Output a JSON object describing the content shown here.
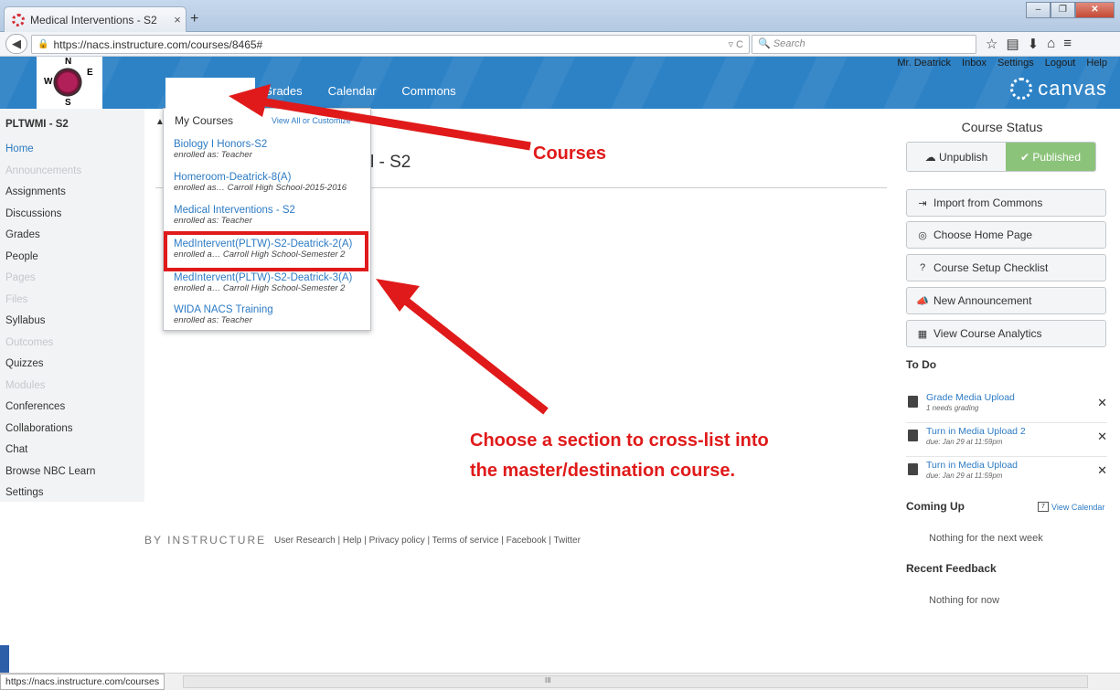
{
  "browser": {
    "tab_title": "Medical Interventions - S2",
    "tab_close": "×",
    "new_tab": "+",
    "url": "https://nacs.instructure.com/courses/8465#",
    "search_placeholder": "Search",
    "status_url": "https://nacs.instructure.com/courses"
  },
  "header": {
    "nav": [
      "Grades",
      "Calendar",
      "Commons"
    ],
    "user_links": [
      "Mr. Deatrick",
      "Inbox",
      "Settings",
      "Logout",
      "Help"
    ],
    "brand": "canvas",
    "logo_letters": {
      "n": "N",
      "w": "W",
      "e": "E",
      "s": "S"
    }
  },
  "left_nav": {
    "course_code": "PLTWMI - S2",
    "items": [
      {
        "label": "Home",
        "state": "active"
      },
      {
        "label": "Announcements",
        "state": "disabled"
      },
      {
        "label": "Assignments",
        "state": "normal"
      },
      {
        "label": "Discussions",
        "state": "normal"
      },
      {
        "label": "Grades",
        "state": "normal"
      },
      {
        "label": "People",
        "state": "normal"
      },
      {
        "label": "Pages",
        "state": "disabled"
      },
      {
        "label": "Files",
        "state": "disabled"
      },
      {
        "label": "Syllabus",
        "state": "normal"
      },
      {
        "label": "Outcomes",
        "state": "disabled"
      },
      {
        "label": "Quizzes",
        "state": "normal"
      },
      {
        "label": "Modules",
        "state": "disabled"
      },
      {
        "label": "Conferences",
        "state": "normal"
      },
      {
        "label": "Collaborations",
        "state": "normal"
      },
      {
        "label": "Chat",
        "state": "normal"
      },
      {
        "label": "Browse NBC Learn",
        "state": "normal"
      },
      {
        "label": "Settings",
        "state": "normal"
      }
    ]
  },
  "main": {
    "page_title": "l - S2"
  },
  "courses_menu": {
    "heading": "My Courses",
    "view_all": "View All or Customize",
    "courses": [
      {
        "name": "Biology I Honors-S2",
        "enrollment": "enrolled as: Teacher"
      },
      {
        "name": "Homeroom-Deatrick-8(A)",
        "enrollment": "enrolled as… Carroll High School-2015-2016"
      },
      {
        "name": "Medical Interventions - S2",
        "enrollment": "enrolled as: Teacher"
      },
      {
        "name": "MedIntervent(PLTW)-S2-Deatrick-2(A)",
        "enrollment": "enrolled a… Carroll High School-Semester 2"
      },
      {
        "name": "MedIntervent(PLTW)-S2-Deatrick-3(A)",
        "enrollment": "enrolled a… Carroll High School-Semester 2"
      },
      {
        "name": "WIDA NACS Training",
        "enrollment": "enrolled as: Teacher"
      }
    ]
  },
  "right_col": {
    "course_status": "Course Status",
    "unpublish": "Unpublish",
    "published": "Published",
    "actions": [
      "Import from Commons",
      "Choose Home Page",
      "Course Setup Checklist",
      "New Announcement",
      "View Course Analytics"
    ],
    "todo_title": "To Do",
    "todos": [
      {
        "name": "Grade Media Upload",
        "sub": "1 needs grading"
      },
      {
        "name": "Turn in Media Upload 2",
        "sub": "due: Jan 29 at 11:59pm"
      },
      {
        "name": "Turn in Media Upload",
        "sub": "due: Jan 29 at 11:59pm"
      }
    ],
    "coming_up": "Coming Up",
    "view_calendar": "View Calendar",
    "calendar_day": "7",
    "coming_up_note": "Nothing for the next week",
    "recent_feedback": "Recent Feedback",
    "feedback_note": "Nothing for now"
  },
  "footer": {
    "brand": "BY INSTRUCTURE",
    "links": "User Research | Help | Privacy policy | Terms of service | Facebook | Twitter"
  },
  "annotations": {
    "courses": "Courses",
    "instruction_line1": "Choose a section to cross-list into",
    "instruction_line2": "the master/destination course."
  },
  "colors": {
    "header_blue": "#2d82c6",
    "link_blue": "#2d7bc4",
    "published_green": "#8cc37a",
    "annotation_red": "#e01a1a"
  }
}
